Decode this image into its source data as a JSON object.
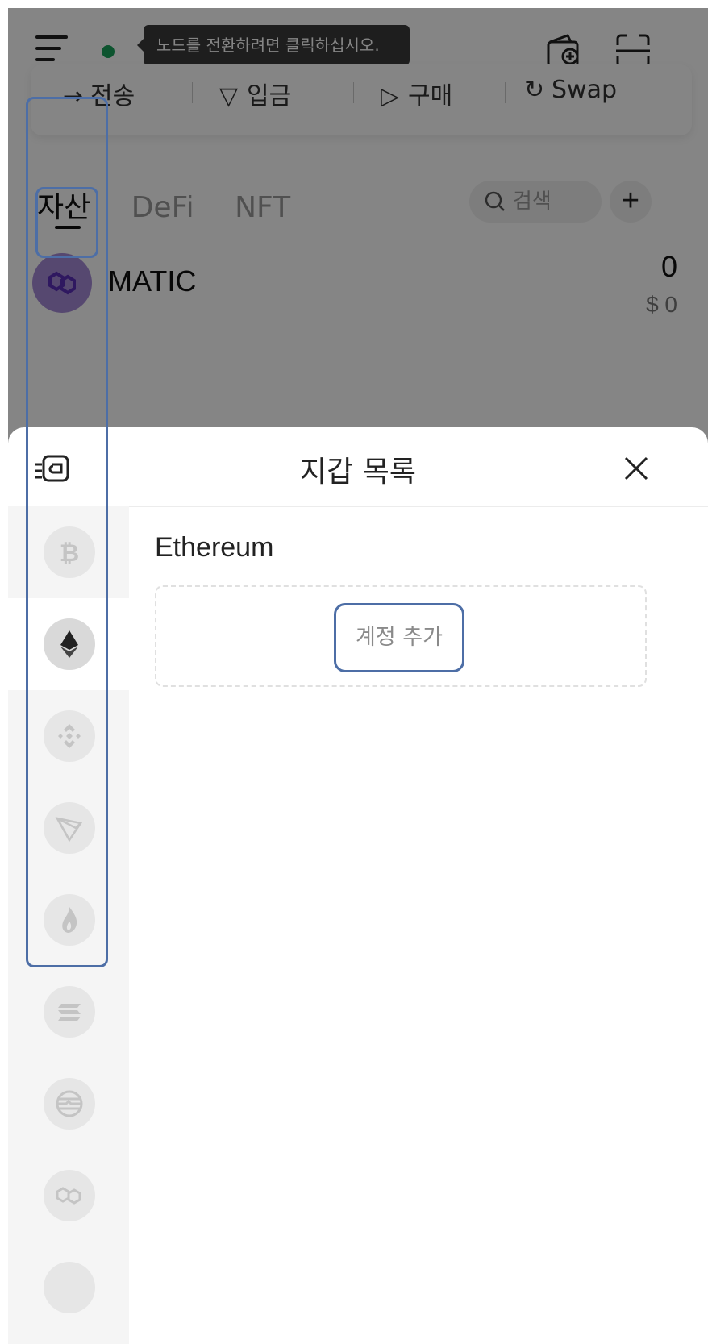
{
  "topbar": {
    "tooltip": "노드를 전환하려면 클릭하십시오.",
    "node_status_color": "#1aa15b"
  },
  "actions": {
    "send": "전송",
    "receive": "입금",
    "buy": "구매",
    "swap": "Swap"
  },
  "tabs": [
    "자산",
    "DeFi",
    "NFT"
  ],
  "search": {
    "placeholder": "검색"
  },
  "asset": {
    "name": "MATIC",
    "amount": "0",
    "usd": "$ 0"
  },
  "sheet": {
    "title": "지갑 목록",
    "selected_chain_name": "Ethereum",
    "add_account_label": "계정 추가",
    "chains": [
      "bitcoin-icon",
      "ethereum-icon",
      "bnb-icon",
      "tron-icon",
      "heco-icon",
      "solana-icon",
      "aptos-icon",
      "polygon-icon"
    ]
  },
  "colors": {
    "highlight": "#4d6ea6"
  }
}
